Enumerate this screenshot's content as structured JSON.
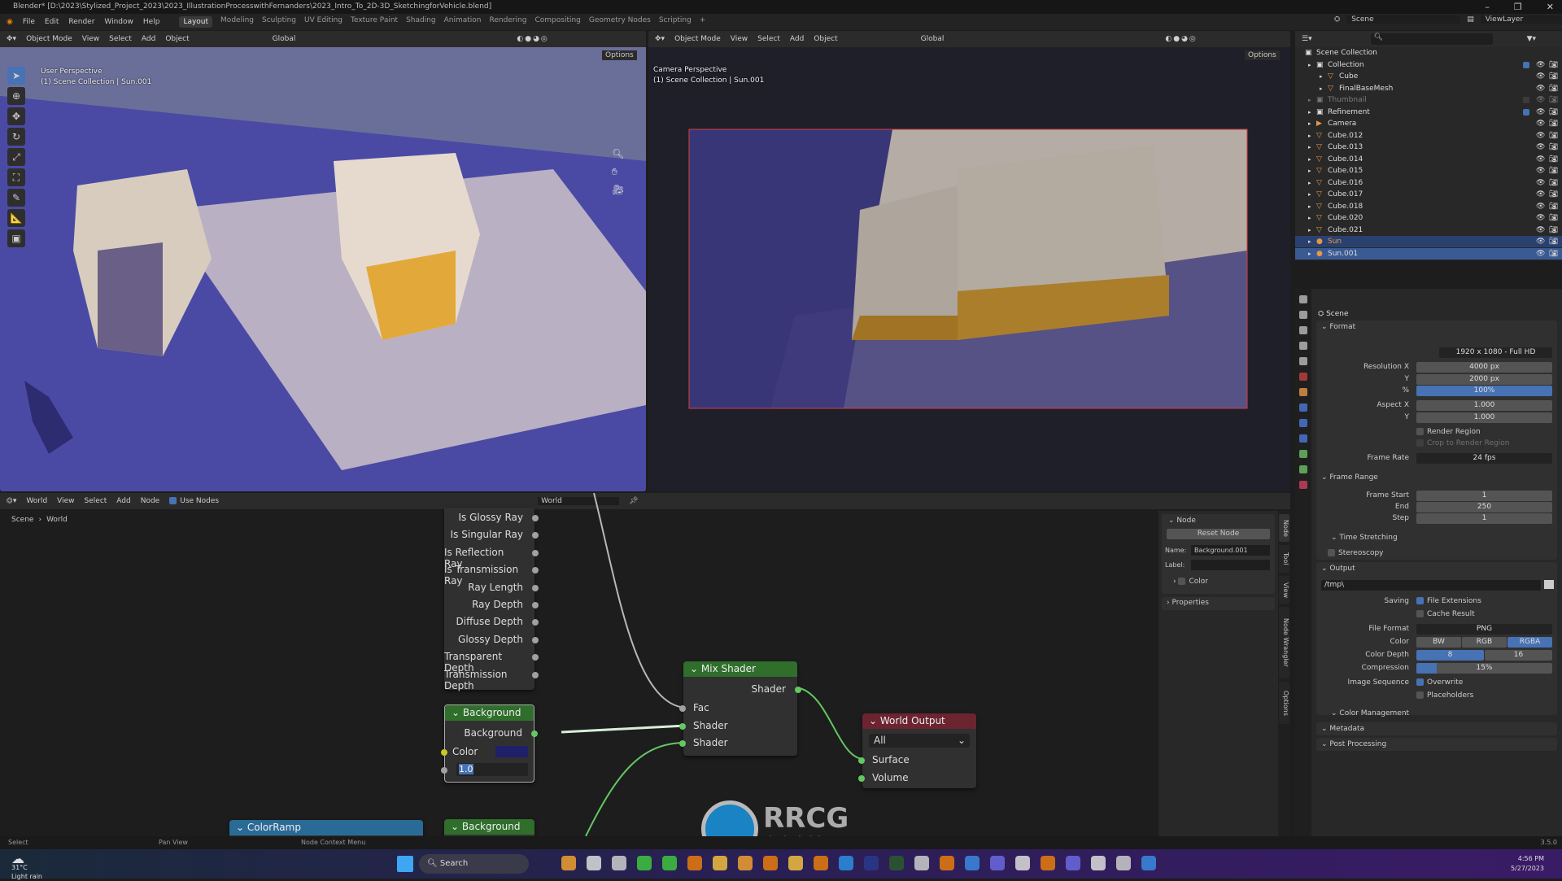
{
  "title": "Blender* [D:\\2023\\Stylized_Project_2023\\2023_IllustrationProcesswithFernanders\\2023_Intro_To_2D-3D_SketchingforVehicle.blend]",
  "menu": [
    "File",
    "Edit",
    "Render",
    "Window",
    "Help"
  ],
  "workspaces": [
    "Layout",
    "Modeling",
    "Sculpting",
    "UV Editing",
    "Texture Paint",
    "Shading",
    "Animation",
    "Rendering",
    "Compositing",
    "Geometry Nodes",
    "Scripting",
    "+"
  ],
  "window_controls": {
    "minimize": "–",
    "maximize": "❐",
    "close": "✕"
  },
  "top_right": {
    "scene": "Scene",
    "view_layer": "ViewLayer"
  },
  "viewport_left": {
    "mode": "Object Mode",
    "menus": [
      "View",
      "Select",
      "Add",
      "Object"
    ],
    "transform": "Global",
    "options": "Options",
    "info1": "User Perspective",
    "info2": "(1) Scene Collection | Sun.001"
  },
  "viewport_right": {
    "mode": "Object Mode",
    "menus": [
      "View",
      "Select",
      "Add",
      "Object"
    ],
    "transform": "Global",
    "options": "Options",
    "info1": "Camera Perspective",
    "info2": "(1) Scene Collection | Sun.001"
  },
  "outliner": {
    "rows": [
      {
        "label": "Scene Collection",
        "icon": "collection",
        "level": 0
      },
      {
        "label": "Collection",
        "icon": "collection",
        "level": 1,
        "checked": true
      },
      {
        "label": "Cube",
        "icon": "mesh",
        "level": 2
      },
      {
        "label": "FinalBaseMesh",
        "icon": "mesh",
        "level": 2
      },
      {
        "label": "Thumbnail",
        "icon": "collection",
        "level": 1,
        "disabled": true
      },
      {
        "label": "Refinement",
        "icon": "collection",
        "level": 1,
        "checked": true
      },
      {
        "label": "Camera",
        "icon": "camera",
        "level": 1
      },
      {
        "label": "Cube.012",
        "icon": "mesh",
        "level": 1
      },
      {
        "label": "Cube.013",
        "icon": "mesh",
        "level": 1
      },
      {
        "label": "Cube.014",
        "icon": "mesh",
        "level": 1
      },
      {
        "label": "Cube.015",
        "icon": "mesh",
        "level": 1
      },
      {
        "label": "Cube.016",
        "icon": "mesh",
        "level": 1
      },
      {
        "label": "Cube.017",
        "icon": "mesh",
        "level": 1
      },
      {
        "label": "Cube.018",
        "icon": "mesh",
        "level": 1
      },
      {
        "label": "Cube.020",
        "icon": "mesh",
        "level": 1
      },
      {
        "label": "Cube.021",
        "icon": "mesh",
        "level": 1
      },
      {
        "label": "Sun",
        "icon": "light",
        "level": 1,
        "selected": true
      },
      {
        "label": "Sun.001",
        "icon": "light",
        "level": 1,
        "active": true
      }
    ]
  },
  "properties": {
    "context": "Scene",
    "format": {
      "title": "Format",
      "preset": "1920 x 1080 - Full HD",
      "res_x_label": "Resolution X",
      "res_x": "4000 px",
      "res_y_label": "Y",
      "res_y": "2000 px",
      "pct_label": "%",
      "pct": "100%",
      "aspect_x_label": "Aspect X",
      "aspect_x": "1.000",
      "aspect_y_label": "Y",
      "aspect_y": "1.000",
      "render_region": "Render Region",
      "crop": "Crop to Render Region",
      "frame_rate_label": "Frame Rate",
      "frame_rate": "24 fps"
    },
    "frame_range": {
      "title": "Frame Range",
      "start_label": "Frame Start",
      "start": "1",
      "end_label": "End",
      "end": "250",
      "step_label": "Step",
      "step": "1",
      "time_stretching": "Time Stretching"
    },
    "stereoscopy": "Stereoscopy",
    "output": {
      "title": "Output",
      "path": "/tmp\\",
      "saving_label": "Saving",
      "file_ext": "File Extensions",
      "cache": "Cache Result",
      "format_label": "File Format",
      "format": "PNG",
      "color_label": "Color",
      "color_opts": [
        "BW",
        "RGB",
        "RGBA"
      ],
      "color_selected": "RGBA",
      "depth_label": "Color Depth",
      "depth_opts": [
        "8",
        "16"
      ],
      "depth_selected": "8",
      "compression_label": "Compression",
      "compression": "15%",
      "compression_value": 15,
      "seq_label": "Image Sequence",
      "overwrite": "Overwrite",
      "placeholders": "Placeholders",
      "color_mgmt": "Color Management"
    },
    "metadata": "Metadata",
    "post_processing": "Post Processing"
  },
  "node_editor": {
    "type": "World",
    "menus": [
      "View",
      "Select",
      "Add",
      "Node"
    ],
    "use_nodes": "Use Nodes",
    "datablock": "World",
    "breadcrumb": [
      "Scene",
      "World"
    ],
    "light_path_outputs": [
      "Is Glossy Ray",
      "Is Singular Ray",
      "Is Reflection Ray",
      "Is Transmission Ray",
      "Ray Length",
      "Ray Depth",
      "Diffuse Depth",
      "Glossy Depth",
      "Transparent Depth",
      "Transmission Depth"
    ],
    "background1": {
      "title": "Background",
      "output": "Background",
      "color_label": "Color",
      "strength": "1.0",
      "color": "#1f1f6a"
    },
    "background2": {
      "title": "Background"
    },
    "colorramp": {
      "title": "ColorRamp"
    },
    "mix": {
      "title": "Mix Shader",
      "output": "Shader",
      "inputs": [
        "Fac",
        "Shader",
        "Shader"
      ]
    },
    "world_output": {
      "title": "World Output",
      "target": "All",
      "inputs": [
        "Surface",
        "Volume"
      ]
    },
    "sidebar": {
      "panel": "Node",
      "reset": "Reset Node",
      "name_label": "Name:",
      "name": "Background.001",
      "label_label": "Label:",
      "label": "",
      "color": "Color",
      "properties": "Properties",
      "tabs": [
        "Node",
        "Tool",
        "View",
        "Node Wrangler",
        "Options"
      ]
    }
  },
  "status": {
    "items": [
      "Select",
      "Pan View",
      "Node Context Menu"
    ],
    "version": "3.5.0"
  },
  "taskbar": {
    "weather_temp": "31°C",
    "weather_desc": "Light rain",
    "search": "Search",
    "time": "4:56 PM",
    "date": "5/27/2023"
  },
  "watermark": {
    "text": "RRCG",
    "sub": "人人素材"
  },
  "colors": {
    "accent": "#4772b3",
    "shader_socket": "#63c763",
    "node_header_shader": "#2f6e2b",
    "node_header_output": "#6b2430",
    "node_header_converter": "#2a6a96",
    "selected_row": "#334d80"
  }
}
